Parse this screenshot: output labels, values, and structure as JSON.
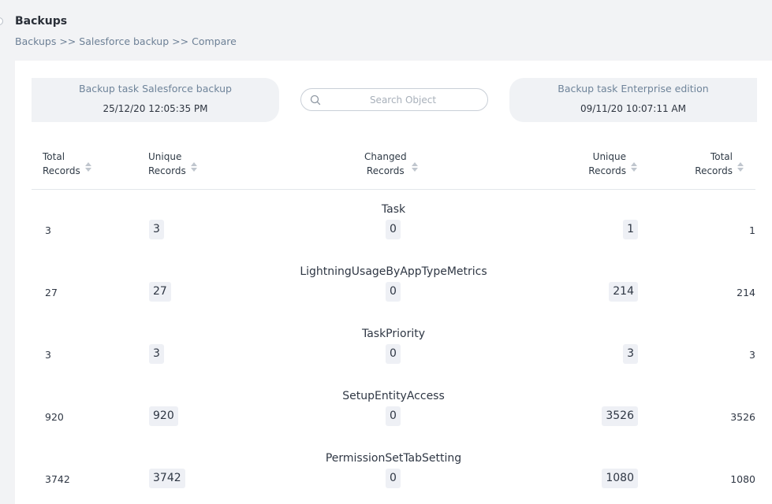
{
  "header": {
    "title": "Backups",
    "breadcrumb": [
      "Backups",
      ">>",
      "Salesforce backup",
      ">>",
      "Compare"
    ]
  },
  "left_backup": {
    "name": "Backup task Salesforce backup",
    "date": "25/12/20 12:05:35 PM"
  },
  "right_backup": {
    "name": "Backup task Enterprise edition",
    "date": "09/11/20 10:07:11 AM"
  },
  "search": {
    "placeholder": "Search Object",
    "value": ""
  },
  "columns": {
    "total_left": [
      "Total",
      "Records"
    ],
    "unique_left": [
      "Unique",
      "Records"
    ],
    "changed": [
      "Changed",
      "Records"
    ],
    "unique_right": [
      "Unique",
      "Records"
    ],
    "total_right": [
      "Total",
      "Records"
    ]
  },
  "rows": [
    {
      "object": "Task",
      "total_left": "3",
      "unique_left": "3",
      "changed": "0",
      "unique_right": "1",
      "total_right": "1"
    },
    {
      "object": "LightningUsageByAppTypeMetrics",
      "total_left": "27",
      "unique_left": "27",
      "changed": "0",
      "unique_right": "214",
      "total_right": "214"
    },
    {
      "object": "TaskPriority",
      "total_left": "3",
      "unique_left": "3",
      "changed": "0",
      "unique_right": "3",
      "total_right": "3"
    },
    {
      "object": "SetupEntityAccess",
      "total_left": "920",
      "unique_left": "920",
      "changed": "0",
      "unique_right": "3526",
      "total_right": "3526"
    },
    {
      "object": "PermissionSetTabSetting",
      "total_left": "3742",
      "unique_left": "3742",
      "changed": "0",
      "unique_right": "1080",
      "total_right": "1080"
    }
  ]
}
